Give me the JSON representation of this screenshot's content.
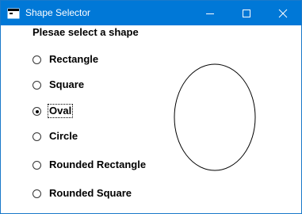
{
  "window": {
    "title": "Shape Selector",
    "icon": "app-window-icon"
  },
  "form": {
    "prompt": "Plesae select a shape",
    "options": [
      {
        "label": "Rectangle",
        "checked": false
      },
      {
        "label": "Square",
        "checked": false
      },
      {
        "label": "Oval",
        "checked": true
      },
      {
        "label": "Circle",
        "checked": false
      },
      {
        "label": "Rounded Rectangle",
        "checked": false
      },
      {
        "label": "Rounded Square",
        "checked": false
      }
    ]
  },
  "preview": {
    "shape": "oval",
    "stroke_color": "#000000",
    "fill_color": "#ffffff"
  },
  "colors": {
    "titlebar": "#0078d7",
    "background": "#ffffff"
  }
}
